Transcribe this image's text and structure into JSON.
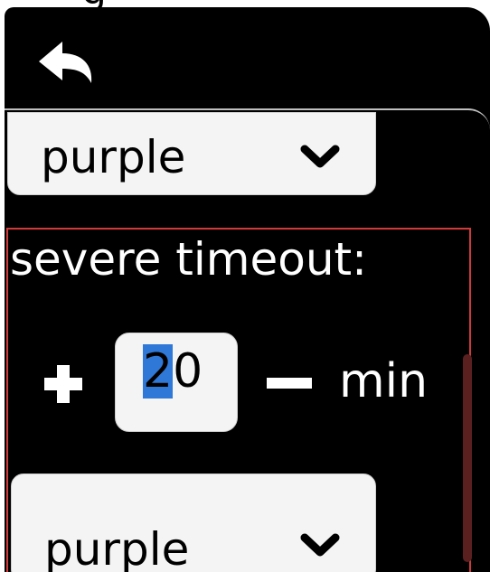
{
  "window": {
    "title_fragment": "g"
  },
  "header": {
    "back_icon": "undo-arrow-icon"
  },
  "color_select_1": {
    "value": "purple",
    "icon": "chevron-down-icon"
  },
  "severe_timeout": {
    "label": "severe timeout:",
    "value": "20",
    "selected_part": "2",
    "unselected_part": "0",
    "unit": "min",
    "plus_icon": "plus-icon",
    "minus_icon": "minus-icon"
  },
  "color_select_2": {
    "value": "purple",
    "icon": "chevron-down-icon"
  },
  "colors": {
    "background": "#000000",
    "select_bg": "#f4f4f4",
    "group_border": "#d23a3a",
    "text_selection": "#2f78d8",
    "scrollbar": "#5a2020"
  }
}
